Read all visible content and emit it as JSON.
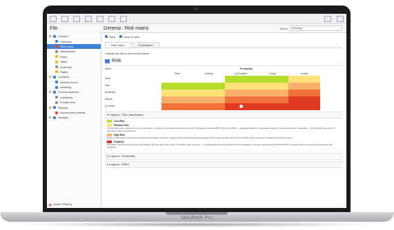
{
  "device": {
    "brand": "MacBook Pro"
  },
  "app": {
    "file_title": "File",
    "page_title": "General : Risk matrix",
    "status_label": "Status",
    "status_value": "Pending"
  },
  "sidebar": {
    "items": [
      {
        "label": "General",
        "level": "group",
        "icon_color": "#3f7fd6"
      },
      {
        "label": "Overview",
        "level": "child",
        "icon_color": "#3f7fd6"
      },
      {
        "label": "Risk matrix",
        "level": "child",
        "icon_color": "#e24a2a",
        "active": true
      },
      {
        "label": "Attachments",
        "level": "child",
        "icon_color": "#8a8f96"
      },
      {
        "label": "Notes",
        "level": "child",
        "icon_color": "#f0b429"
      },
      {
        "label": "Tasks",
        "level": "child",
        "icon_color": "#f0b429"
      },
      {
        "label": "Audit trail",
        "level": "child",
        "icon_color": "#8a8f96"
      },
      {
        "label": "Rights",
        "level": "child",
        "icon_color": "#f0b429"
      },
      {
        "label": "Contacts",
        "level": "group",
        "icon_color": "#3f7fd6"
      },
      {
        "label": "Adverse event",
        "level": "child",
        "icon_color": "#3f7fd6"
      },
      {
        "label": "Labelling",
        "level": "child",
        "icon_color": "#3f7fd6"
      },
      {
        "label": "Correspondence",
        "level": "group",
        "icon_color": "#3f7fd6"
      },
      {
        "label": "Invitations",
        "level": "child",
        "icon_color": "#8a8f96"
      },
      {
        "label": "E-mails sent",
        "level": "child",
        "icon_color": "#8a8f96"
      },
      {
        "label": "Related",
        "level": "group",
        "icon_color": "#3f7fd6"
      },
      {
        "label": "Improvement actions",
        "level": "child",
        "icon_color": "#e24a2a"
      },
      {
        "label": "Analysis",
        "level": "group",
        "icon_color": "#3f7fd6"
      }
    ],
    "user": "Admin CRMS ▴"
  },
  "toolbar": {
    "save_label": "Save",
    "save_close_label": "Save & close"
  },
  "tabs": [
    {
      "label": "Risk matrix",
      "active": true
    },
    {
      "label": "Explanation",
      "active": false
    }
  ],
  "hint": "Classify the risk in the screen below.",
  "risk_title": "Risk",
  "matrix": {
    "effect_label": "Effect",
    "probability_label": "Probability",
    "columns": [
      "Rare",
      "Unlikely",
      "(x) Possible",
      "Likely",
      "Certain"
    ],
    "rows": [
      "None",
      "Mild",
      "Moderate",
      "Severe",
      "(x) Death"
    ],
    "colors": [
      [
        "#ffffff",
        "#ffffff",
        "#b6dd2a",
        "#b6dd2a",
        "#ffe17a"
      ],
      [
        "#b6dd2a",
        "#b6dd2a",
        "#ffe17a",
        "#ffe17a",
        "#f9b06a"
      ],
      [
        "#ffe17a",
        "#ffe17a",
        "#f9b06a",
        "#f9b06a",
        "#f07238"
      ],
      [
        "#f9b06a",
        "#f9b06a",
        "#f07238",
        "#f07238",
        "#e23a22"
      ],
      [
        "#f07238",
        "#f07238",
        "#e23a22",
        "#e23a22",
        "#e23a22"
      ]
    ],
    "selected": {
      "row": "(x) Death",
      "column": "(x) Possible"
    }
  },
  "legends": {
    "classification_label": "Legends : Risk classification",
    "probability_label": "Legends : Probability",
    "effect_label": "Legends : Effect",
    "items": [
      {
        "name": "Low Risk",
        "color": "#b6dd2a",
        "text": ""
      },
      {
        "name": "Medium Risk",
        "color": "#ffe17a",
        "text": "Consult the involved persons for more information. Formulate a conclusion and close the report. Management responsibility must be specified — Aggregate data then undertake a practice improvement project. Exception — all financial losses must be reported to senior management."
      },
      {
        "name": "High Risk",
        "color": "#f9b06a",
        "text": "Need to notify senior management. Detailed investigation required. Ongoing monitoring of trended aggregated incident data may also identify and prioritise issues requiring a practice improvement project."
      },
      {
        "name": "Calamity",
        "color": "#e23a22",
        "text": "The Board of Directors have been automatically informed about this report. Immediate action required — A Privileged Root Cause Analysis (RCA) investigation must be undertaken for all Clinical SAC 1 incidents with a report being submitted to the Inspection."
      }
    ]
  }
}
